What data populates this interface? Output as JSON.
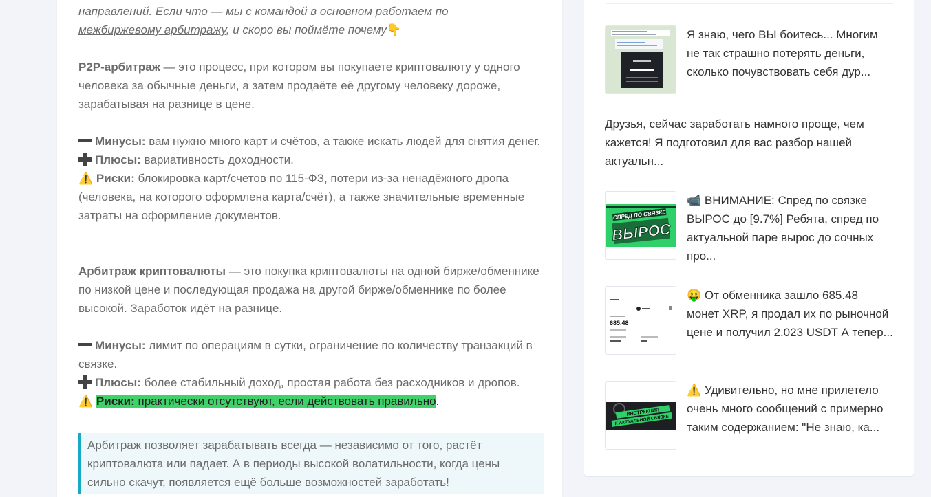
{
  "article": {
    "intro_line1": "направлений. Если что — мы с командой в основном работаем по",
    "intro_link": "межбиржевому арбитражу",
    "intro_rest": ", и скоро вы поймёте почему",
    "pointing_emoji": "👇",
    "p2p_term": "P2P-арбитраж",
    "p2p_text": " — это процесс, при котором вы покупаете криптовалюту у одного человека за обычные деньги, а затем продаёте её другому человеку дороже, зарабатывая на разнице в цене.",
    "p2p_minus_label": "Минусы:",
    "p2p_minus_text": " вам нужно много карт и счётов, а также искать людей для снятия денег.",
    "p2p_plus_label": "Плюсы:",
    "p2p_plus_text": " вариативность доходности.",
    "p2p_risk_label": "Риски:",
    "p2p_risk_text": " блокировка карт/счетов по 115-ФЗ, потери из-за ненадёжного дропа (человека, на которого оформлена карта/счёт), а также значительные временные затраты на оформление документов.",
    "crypto_term": "Арбитраж криптовалюты",
    "crypto_text": " — это покупка криптовалюты на одной бирже/обменнике по низкой цене и последующая продажа на другой бирже/обменнике по более высокой. Заработок идёт на разнице.",
    "crypto_minus_label": "Минусы:",
    "crypto_minus_text": " лимит по операциям в сутки, ограничение по количеству транзакций в связке.",
    "crypto_plus_label": "Плюсы:",
    "crypto_plus_text": " более стабильный доход, простая работа без расходников и дропов.",
    "crypto_risk_label": "Риски:",
    "crypto_risk_text": " практически отсутствуют, если действовать правильно",
    "crypto_risk_end": ".",
    "warning_emoji": "⚠️",
    "quote": "Арбитраж позволяет зарабатывать всегда — независимо от того, растёт криптовалюта или падает. А в периоды высокой волатильности, когда цены сильно скачут, появляется ещё больше возможностей заработать!"
  },
  "sidebar": {
    "posts": [
      {
        "title": "Я знаю, чего ВЫ боитесь... Многим не так страшно потерять деньги, сколько почувствовать себя дур..."
      },
      {
        "title": "Друзья, сейчас заработать намного проще, чем кажется! Я подготовил для вас разбор нашей актуальн..."
      },
      {
        "title": "📹 ВНИМАНИЕ: Спред по связке ВЫРОС до [9.7%] Ребята, спред по актуальной паре вырос до сочных про...",
        "thumb_text": "СПРЕД ПО СВЯЗКЕ ВЫРОС"
      },
      {
        "title": "🤑 От обменника зашло 685.48 монет XRP, я продал их по рыночной цене и получил 2.023 USDT А тепер...",
        "thumb_amount": "685.48"
      },
      {
        "title": "⚠️ Удивительно, но мне прилетело очень много сообщений с примерно таким содержанием: \"Не знаю, ка...",
        "thumb_text": "ИНСТРУКЦИЯ К АКТУАЛЬНОЙ СВЯЗКЕ"
      }
    ]
  },
  "colors": {
    "highlight": "#3fd16a",
    "quote_border": "#16aac5",
    "quote_bg": "#eef8fb",
    "thumb_green": "#2fd06a"
  }
}
